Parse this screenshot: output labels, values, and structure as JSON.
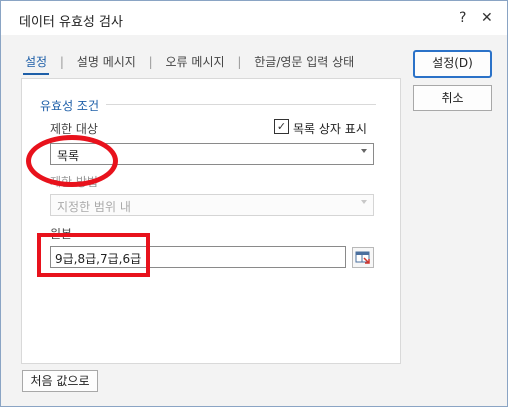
{
  "dialog": {
    "title": "데이터 유효성 검사",
    "help": "?",
    "close": "✕"
  },
  "tabs": [
    {
      "label": "설정"
    },
    {
      "label": "설명 메시지"
    },
    {
      "label": "오류 메시지"
    },
    {
      "label": "한글/영문 입력 상태"
    }
  ],
  "group": {
    "title": "유효성 조건"
  },
  "allow": {
    "label": "제한 대상",
    "value": "목록"
  },
  "dropdown_option": {
    "label": "목록 상자 표시",
    "checked": true,
    "check_glyph": "✓"
  },
  "data": {
    "label": "제한 방법",
    "value": "지정한 범위 내"
  },
  "source": {
    "label": "원본",
    "value": "9급,8급,7급,6급"
  },
  "buttons": {
    "ok": "설정(D)",
    "cancel": "취소",
    "reset": "처음 값으로"
  },
  "colors": {
    "accent": "#1e5fa8",
    "highlight": "#e8121c"
  }
}
